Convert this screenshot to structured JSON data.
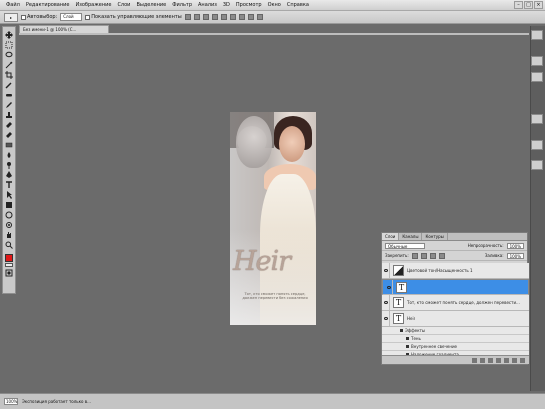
{
  "menu": [
    "Файл",
    "Редактирование",
    "Изображение",
    "Слои",
    "Выделение",
    "Фильтр",
    "Анализ",
    "3D",
    "Просмотр",
    "Окно",
    "Справка"
  ],
  "window_buttons": [
    "–",
    "□",
    "×"
  ],
  "options": {
    "preset": "▸",
    "autoselect_label": "Автовыбор:",
    "autoselect_value": "Слой",
    "transform_label": "Показать управляющие элементы"
  },
  "document_tab": "Без имени-1 @ 100% (С...",
  "colors": {
    "foreground": "#e01818",
    "selection": "#3d8ee6"
  },
  "canvas": {
    "script_text": "Heir",
    "quote": "Тот, кто сможет понять сердце, должен перевести без сожаления"
  },
  "layers_panel": {
    "tabs": [
      "Слои",
      "Каналы",
      "Контуры"
    ],
    "blend_mode": "Обычные",
    "opacity_label": "Непрозрачность:",
    "opacity_value": "100%",
    "lock_label": "Закрепить:",
    "fill_label": "Заливка:",
    "fill_value": "100%",
    "layers": [
      {
        "type": "adjustment",
        "name": "Цветовой тон/Насыщенность 1",
        "visible": true,
        "selected": false
      },
      {
        "type": "text",
        "name": "",
        "visible": true,
        "selected": true
      },
      {
        "type": "text",
        "name": "Тот, кто сможет понять сердце, должен перевести...",
        "visible": true,
        "selected": false
      },
      {
        "type": "text",
        "name": "Heir",
        "visible": true,
        "selected": false
      }
    ],
    "effects_label": "Эффекты",
    "effects": [
      "Тень",
      "Внутреннее свечение",
      "Наложение градиента"
    ]
  },
  "status": {
    "zoom": "100%",
    "text": "Экспозиция работает только в..."
  }
}
